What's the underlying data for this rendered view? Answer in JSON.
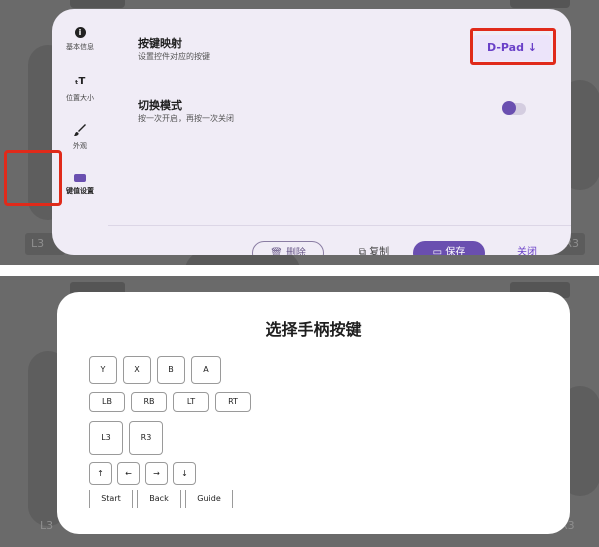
{
  "panel1": {
    "sidebar": [
      {
        "icon": "info-icon",
        "label": "基本信息"
      },
      {
        "icon": "text-size-icon",
        "label": "位置大小"
      },
      {
        "icon": "brush-icon",
        "label": "外观"
      },
      {
        "icon": "keyboard-icon",
        "label": "键值设置"
      }
    ],
    "row1": {
      "title": "按键映射",
      "subtitle": "设置控件对应的按键",
      "value": "D-Pad ↓"
    },
    "row2": {
      "title": "切换模式",
      "subtitle": "按一次开启，再按一次关闭",
      "toggle_on": true
    },
    "actions": {
      "delete": "删除",
      "copy": "复制",
      "save": "保存",
      "close": "关闭"
    },
    "bg_labels": {
      "left": "L3",
      "right": "R3"
    },
    "accent": "#6a4fb0",
    "highlight": "#e02a1a"
  },
  "panel2": {
    "title": "选择手柄按键",
    "face_buttons": [
      "Y",
      "X",
      "B",
      "A"
    ],
    "shoulder_buttons": [
      "LB",
      "RB",
      "LT",
      "RT"
    ],
    "stick_buttons": [
      "L3",
      "R3"
    ],
    "dpad_buttons": [
      "↑",
      "←",
      "→",
      "↓"
    ],
    "system_buttons": [
      "Start",
      "Back",
      "Guide"
    ],
    "bg_labels": {
      "left": "L3",
      "right": "R3"
    }
  }
}
